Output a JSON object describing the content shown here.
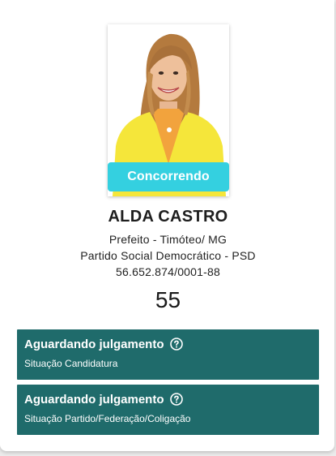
{
  "candidate": {
    "status_tag": "Concorrendo",
    "name": "ALDA CASTRO",
    "office_line": "Prefeito - Timóteo/ MG",
    "party_line": "Partido Social Democrático - PSD",
    "cnpj": "56.652.874/0001-88",
    "number": "55"
  },
  "status_boxes": [
    {
      "title": "Aguardando julgamento",
      "subtitle": "Situação Candidatura",
      "icon": "help-circle-icon"
    },
    {
      "title": "Aguardando julgamento",
      "subtitle": "Situação Partido/Federação/Coligação",
      "icon": "help-circle-icon"
    }
  ],
  "colors": {
    "status_tag_bg": "#34d0e0",
    "status_box_bg": "#1f6b6b",
    "jacket": "#f5e63a"
  }
}
